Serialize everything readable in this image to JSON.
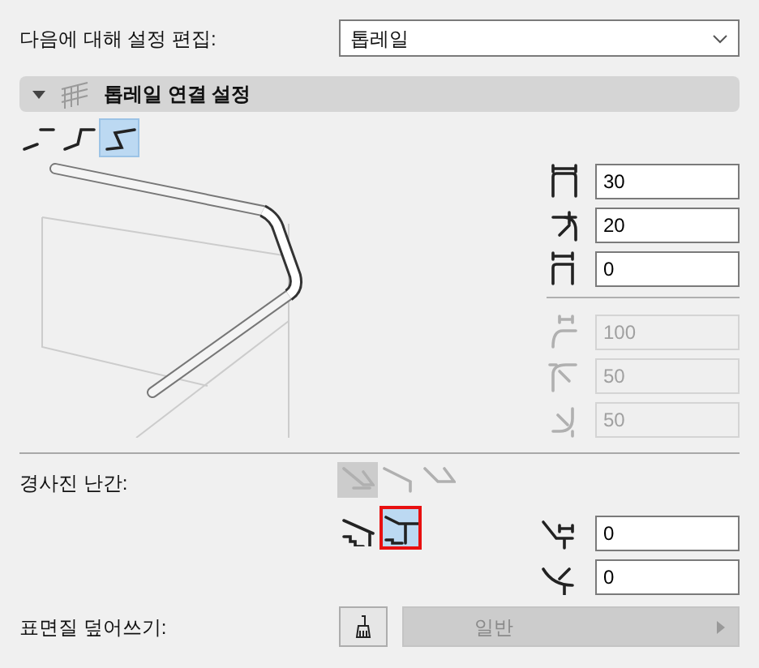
{
  "edit_settings_for": {
    "label": "다음에 대해 설정 편집:",
    "value": "톱레일"
  },
  "section": {
    "title": "톱레일 연결 설정",
    "expanded": true
  },
  "connection_types": [
    {
      "selected": false
    },
    {
      "selected": false
    },
    {
      "selected": true
    }
  ],
  "parameters": [
    {
      "value": "30",
      "disabled": false
    },
    {
      "value": "20",
      "disabled": false
    },
    {
      "value": "0",
      "disabled": false
    },
    {
      "value": "100",
      "disabled": true
    },
    {
      "value": "50",
      "disabled": true
    },
    {
      "value": "50",
      "disabled": true
    }
  ],
  "sloped_segment": {
    "label": "경사진 난간:",
    "disabled": true,
    "options": [
      {
        "selected": true
      },
      {
        "selected": false
      },
      {
        "selected": false
      }
    ],
    "modes": [
      {
        "selected": false
      },
      {
        "selected": true
      }
    ],
    "parameters": [
      {
        "value": "0"
      },
      {
        "value": "0"
      }
    ]
  },
  "surface_override": {
    "label": "표면질 덮어쓰기:",
    "value": "일반",
    "disabled": true
  }
}
